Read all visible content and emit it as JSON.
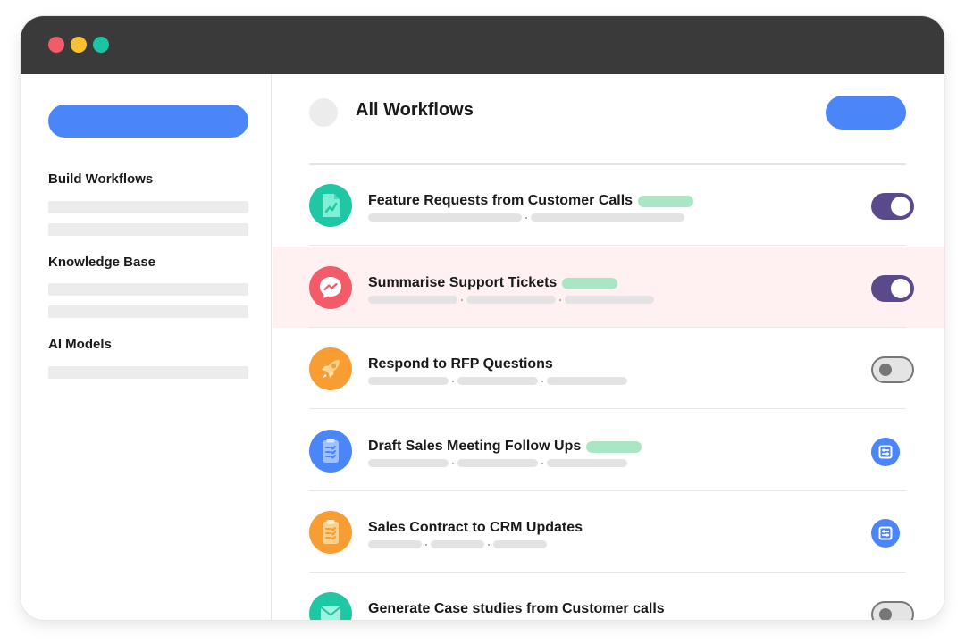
{
  "sidebar": {
    "sections": [
      {
        "heading": "Build Workflows"
      },
      {
        "heading": "Knowledge Base"
      },
      {
        "heading": "AI Models"
      }
    ]
  },
  "main": {
    "title": "All Workflows",
    "workflows": [
      {
        "title": "Feature Requests from Customer Calls",
        "icon": "chart-document-icon",
        "icon_color": "#1fc7a4",
        "tag": true,
        "control": "toggle",
        "enabled": true
      },
      {
        "title": "Summarise Support Tickets",
        "icon": "messenger-icon",
        "icon_color": "#f45b69",
        "tag": true,
        "control": "toggle",
        "enabled": true,
        "highlighted": true
      },
      {
        "title": "Respond to RFP Questions",
        "icon": "rocket-icon",
        "icon_color": "#f79d33",
        "tag": false,
        "control": "toggle",
        "enabled": false
      },
      {
        "title": "Draft Sales Meeting Follow Ups",
        "icon": "clipboard-checklist-icon",
        "icon_color": "#4a86f7",
        "tag": true,
        "control": "settings-button"
      },
      {
        "title": "Sales Contract to CRM Updates",
        "icon": "clipboard-checklist-icon",
        "icon_color": "#f79d33",
        "tag": false,
        "control": "settings-button"
      },
      {
        "title": "Generate Case studies from Customer calls",
        "icon": "envelope-icon",
        "icon_color": "#1fc7a4",
        "tag": false,
        "control": "toggle",
        "enabled": false
      }
    ]
  },
  "colors": {
    "accent": "#4a86f7",
    "toggle_on": "#5a4a8c",
    "tag": "#a9e6c3",
    "highlight_row": "#fff1f1",
    "titlebar": "#3a3a3a"
  }
}
